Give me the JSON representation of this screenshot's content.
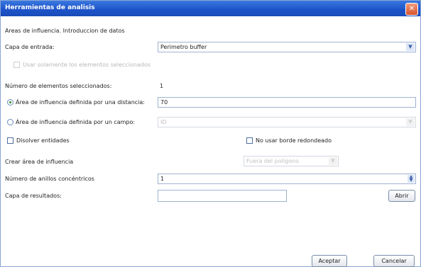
{
  "window": {
    "title": "Herramientas de analisis",
    "close_glyph": "✕"
  },
  "header": {
    "subtitle": "Areas de influencia. Introduccion de datos"
  },
  "input_layer": {
    "label": "Capa de entrada:",
    "value": "Perimetro buffer"
  },
  "only_selected": {
    "label": "Usar solamente los elementos seleccionados"
  },
  "selected_count": {
    "label": "Número de elementos seleccionados:",
    "value": "1"
  },
  "distance_option": {
    "label": "Área de influencia definida por una distancia:",
    "value": "70"
  },
  "field_option": {
    "label": "Área de influencia definida por un campo:",
    "value": "ID"
  },
  "dissolve": {
    "label": "Disolver entidades"
  },
  "no_round": {
    "label": "No usar borde redondeado"
  },
  "create_area": {
    "label": "Crear área de influencia",
    "value": "Fuera del poligono"
  },
  "rings": {
    "label": "Número de anillos concéntricos",
    "value": "1"
  },
  "output_layer": {
    "label": "Capa de resultados:",
    "value": "",
    "open_button": "Abrir"
  },
  "footer": {
    "accept_button": "Aceptar",
    "cancel_button": "Cancelar"
  },
  "icons": {
    "dropdown": "chevron-down-icon",
    "spinner": "spinner-arrows-icon"
  }
}
